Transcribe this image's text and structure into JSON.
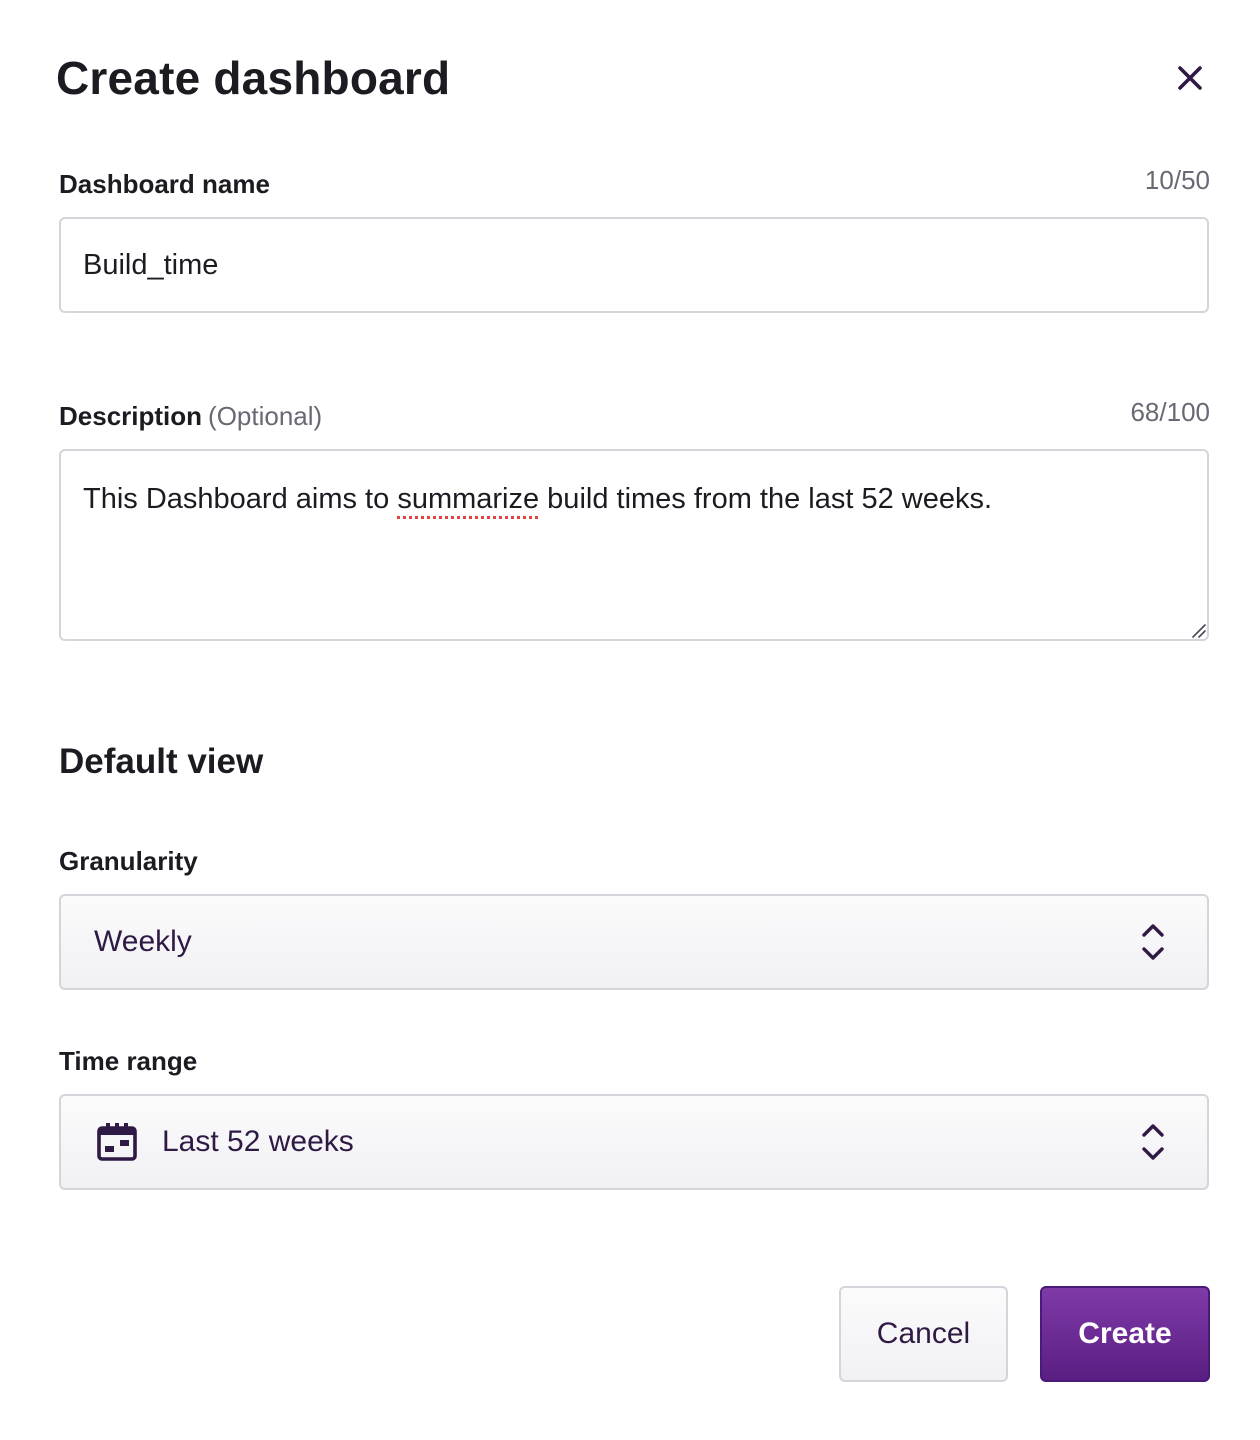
{
  "dialog": {
    "title": "Create dashboard"
  },
  "name_field": {
    "label": "Dashboard name",
    "counter": "10/50",
    "value": "Build_time"
  },
  "description_field": {
    "label": "Description",
    "optional": "(Optional)",
    "counter": "68/100",
    "value_before": "This Dashboard aims to ",
    "value_spell": "summarize",
    "value_after": " build times from the last 52 weeks."
  },
  "default_view": {
    "title": "Default view",
    "granularity": {
      "label": "Granularity",
      "selected": "Weekly"
    },
    "time_range": {
      "label": "Time range",
      "selected": "Last 52 weeks"
    }
  },
  "actions": {
    "cancel_label": "Cancel",
    "create_label": "Create"
  },
  "icons": {
    "close": "close-icon",
    "select": "chevron-up-down-icon",
    "calendar": "calendar-icon",
    "resize": "resize-grip-icon"
  },
  "colors": {
    "text": "#1d1a22",
    "secondary_text": "#6b6775",
    "select_text": "#2f1a45",
    "border": "#d6d3da",
    "accent": "#6a2596",
    "accent_dark": "#4a1a78",
    "spellcheck": "#e0443e"
  }
}
